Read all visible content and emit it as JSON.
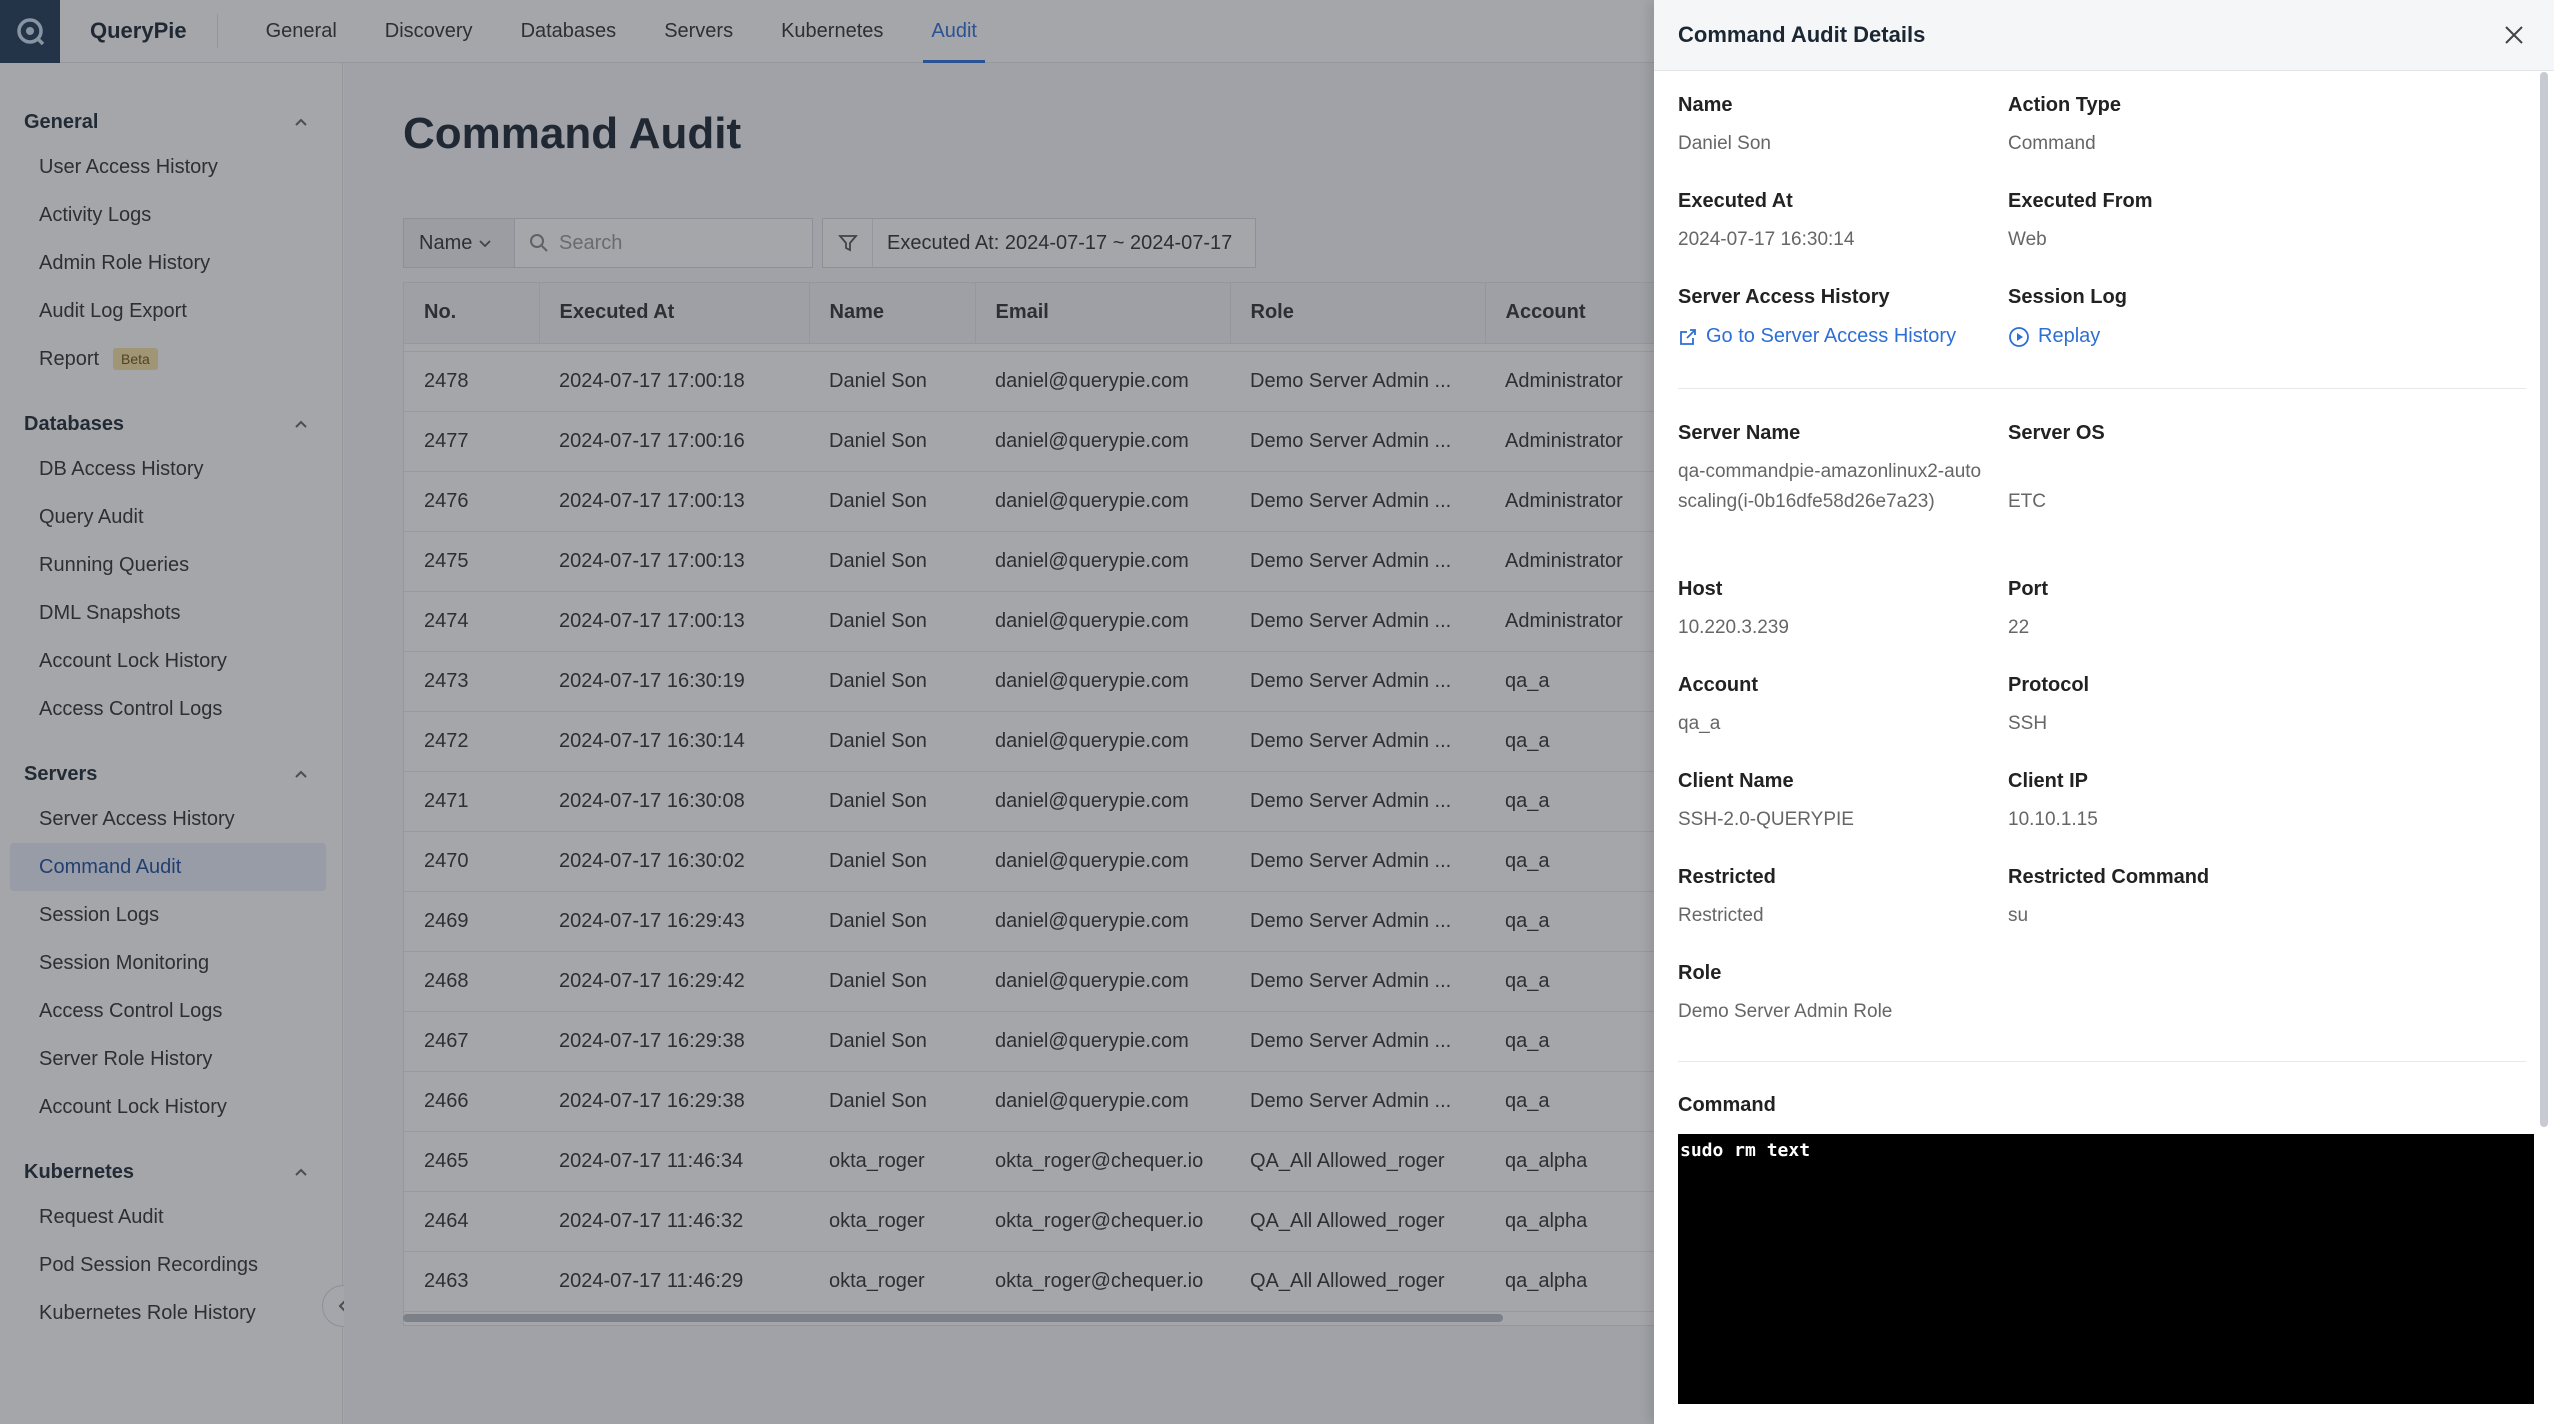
{
  "app": {
    "brand": "QueryPie"
  },
  "topnav": {
    "items": [
      {
        "label": "General"
      },
      {
        "label": "Discovery"
      },
      {
        "label": "Databases"
      },
      {
        "label": "Servers"
      },
      {
        "label": "Kubernetes"
      },
      {
        "label": "Audit",
        "active": true
      }
    ]
  },
  "sidebar": {
    "groups": [
      {
        "title": "General",
        "items": [
          "User Access History",
          "Activity Logs",
          "Admin Role History",
          "Audit Log Export",
          "Report"
        ],
        "badge": "Beta"
      },
      {
        "title": "Databases",
        "items": [
          "DB Access History",
          "Query Audit",
          "Running Queries",
          "DML Snapshots",
          "Account Lock History",
          "Access Control Logs"
        ]
      },
      {
        "title": "Servers",
        "items": [
          "Server Access History",
          "Command Audit",
          "Session Logs",
          "Session Monitoring",
          "Access Control Logs",
          "Server Role History",
          "Account Lock History"
        ],
        "active": "Command Audit"
      },
      {
        "title": "Kubernetes",
        "items": [
          "Request Audit",
          "Pod Session Recordings",
          "Kubernetes Role History"
        ]
      }
    ]
  },
  "main": {
    "title": "Command Audit",
    "filter": {
      "name_select": "Name",
      "search_placeholder": "Search",
      "date_filter": "Executed At: 2024-07-17 ~ 2024-07-17"
    },
    "table": {
      "columns": [
        "No.",
        "Executed At",
        "Name",
        "Email",
        "Role",
        "Account"
      ],
      "rows": [
        [
          "2478",
          "2024-07-17 17:00:18",
          "Daniel Son",
          "daniel@querypie.com",
          "Demo Server Admin ...",
          "Administrator"
        ],
        [
          "2477",
          "2024-07-17 17:00:16",
          "Daniel Son",
          "daniel@querypie.com",
          "Demo Server Admin ...",
          "Administrator"
        ],
        [
          "2476",
          "2024-07-17 17:00:13",
          "Daniel Son",
          "daniel@querypie.com",
          "Demo Server Admin ...",
          "Administrator"
        ],
        [
          "2475",
          "2024-07-17 17:00:13",
          "Daniel Son",
          "daniel@querypie.com",
          "Demo Server Admin ...",
          "Administrator"
        ],
        [
          "2474",
          "2024-07-17 17:00:13",
          "Daniel Son",
          "daniel@querypie.com",
          "Demo Server Admin ...",
          "Administrator"
        ],
        [
          "2473",
          "2024-07-17 16:30:19",
          "Daniel Son",
          "daniel@querypie.com",
          "Demo Server Admin ...",
          "qa_a"
        ],
        [
          "2472",
          "2024-07-17 16:30:14",
          "Daniel Son",
          "daniel@querypie.com",
          "Demo Server Admin ...",
          "qa_a"
        ],
        [
          "2471",
          "2024-07-17 16:30:08",
          "Daniel Son",
          "daniel@querypie.com",
          "Demo Server Admin ...",
          "qa_a"
        ],
        [
          "2470",
          "2024-07-17 16:30:02",
          "Daniel Son",
          "daniel@querypie.com",
          "Demo Server Admin ...",
          "qa_a"
        ],
        [
          "2469",
          "2024-07-17 16:29:43",
          "Daniel Son",
          "daniel@querypie.com",
          "Demo Server Admin ...",
          "qa_a"
        ],
        [
          "2468",
          "2024-07-17 16:29:42",
          "Daniel Son",
          "daniel@querypie.com",
          "Demo Server Admin ...",
          "qa_a"
        ],
        [
          "2467",
          "2024-07-17 16:29:38",
          "Daniel Son",
          "daniel@querypie.com",
          "Demo Server Admin ...",
          "qa_a"
        ],
        [
          "2466",
          "2024-07-17 16:29:38",
          "Daniel Son",
          "daniel@querypie.com",
          "Demo Server Admin ...",
          "qa_a"
        ],
        [
          "2465",
          "2024-07-17 11:46:34",
          "okta_roger",
          "okta_roger@chequer.io",
          "QA_All Allowed_roger",
          "qa_alpha"
        ],
        [
          "2464",
          "2024-07-17 11:46:32",
          "okta_roger",
          "okta_roger@chequer.io",
          "QA_All Allowed_roger",
          "qa_alpha"
        ],
        [
          "2463",
          "2024-07-17 11:46:29",
          "okta_roger",
          "okta_roger@chequer.io",
          "QA_All Allowed_roger",
          "qa_alpha"
        ]
      ]
    }
  },
  "drawer": {
    "title": "Command Audit Details",
    "name_label": "Name",
    "name_value": "Daniel Son",
    "action_type_label": "Action Type",
    "action_type_value": "Command",
    "executed_at_label": "Executed At",
    "executed_at_value": "2024-07-17 16:30:14",
    "executed_from_label": "Executed From",
    "executed_from_value": "Web",
    "server_access_history_label": "Server Access History",
    "server_access_history_link": "Go to Server Access History",
    "session_log_label": "Session Log",
    "session_log_link": "Replay",
    "server_name_label": "Server Name",
    "server_name_value": "qa-commandpie-amazonlinux2-autoscaling(i-0b16dfe58d26e7a23)",
    "server_os_label": "Server OS",
    "server_os_value": "ETC",
    "host_label": "Host",
    "host_value": "10.220.3.239",
    "port_label": "Port",
    "port_value": "22",
    "account_label": "Account",
    "account_value": "qa_a",
    "protocol_label": "Protocol",
    "protocol_value": "SSH",
    "client_name_label": "Client Name",
    "client_name_value": "SSH-2.0-QUERYPIE",
    "client_ip_label": "Client IP",
    "client_ip_value": "10.10.1.15",
    "restricted_label": "Restricted",
    "restricted_value": "Restricted",
    "restricted_command_label": "Restricted Command",
    "restricted_command_value": "su",
    "role_label": "Role",
    "role_value": "Demo Server Admin Role",
    "command_label": "Command",
    "command_value": "sudo rm text"
  },
  "colors": {
    "accent": "#2d6fd6",
    "logo_bg": "#1f3b57",
    "terminal_bg": "#000000",
    "beta_badge": "#f7e4a6"
  }
}
